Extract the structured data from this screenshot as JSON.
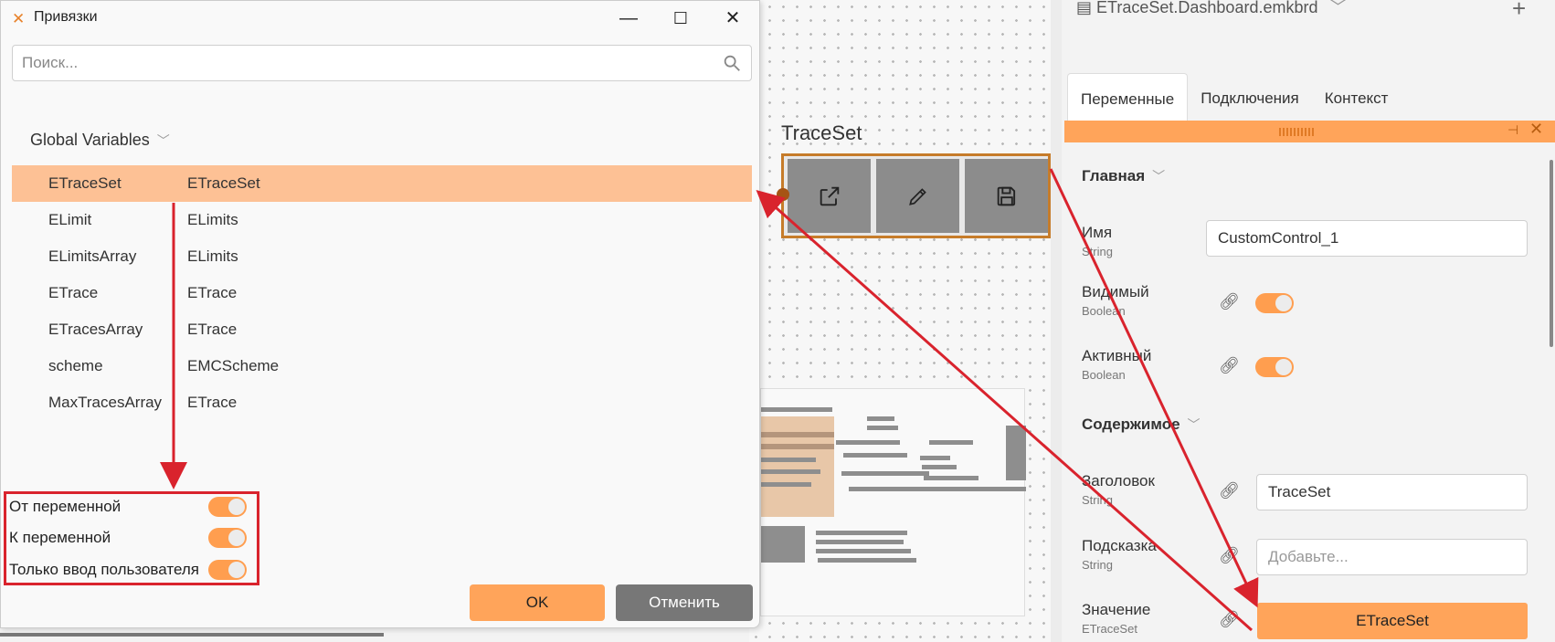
{
  "dialog": {
    "title": "Привязки",
    "search_placeholder": "Поиск...",
    "group": "Global Variables",
    "variables": [
      {
        "name": "ETraceSet",
        "type": "ETraceSet"
      },
      {
        "name": "ELimit",
        "type": "ELimits"
      },
      {
        "name": "ELimitsArray",
        "type": "ELimits"
      },
      {
        "name": "ETrace",
        "type": "ETrace"
      },
      {
        "name": "ETracesArray",
        "type": "ETrace"
      },
      {
        "name": "scheme",
        "type": "EMCScheme"
      },
      {
        "name": "MaxTracesArray",
        "type": "ETrace"
      }
    ],
    "options": [
      "От переменной",
      "К переменной",
      "Только ввод пользователя"
    ],
    "ok": "OK",
    "cancel": "Отменить"
  },
  "canvas": {
    "control_label": "TraceSet"
  },
  "panel": {
    "file_title": "ETraceSet.Dashboard.emkbrd",
    "tabs": [
      "Переменные",
      "Подключения",
      "Контекст"
    ],
    "section_main": "Главная",
    "section_content": "Содержимое",
    "props": {
      "name": {
        "label": "Имя",
        "type": "String",
        "value": "CustomControl_1"
      },
      "visible": {
        "label": "Видимый",
        "type": "Boolean"
      },
      "enabled": {
        "label": "Активный",
        "type": "Boolean"
      },
      "header": {
        "label": "Заголовок",
        "type": "String",
        "value": "TraceSet"
      },
      "tooltip": {
        "label": "Подсказка",
        "type": "String",
        "placeholder": "Добавьте..."
      },
      "value": {
        "label": "Значение",
        "type": "ETraceSet",
        "value": "ETraceSet"
      }
    }
  },
  "colors": {
    "accent": "#ffa45a",
    "selection": "#fdc195",
    "annotation": "#d9232d"
  }
}
